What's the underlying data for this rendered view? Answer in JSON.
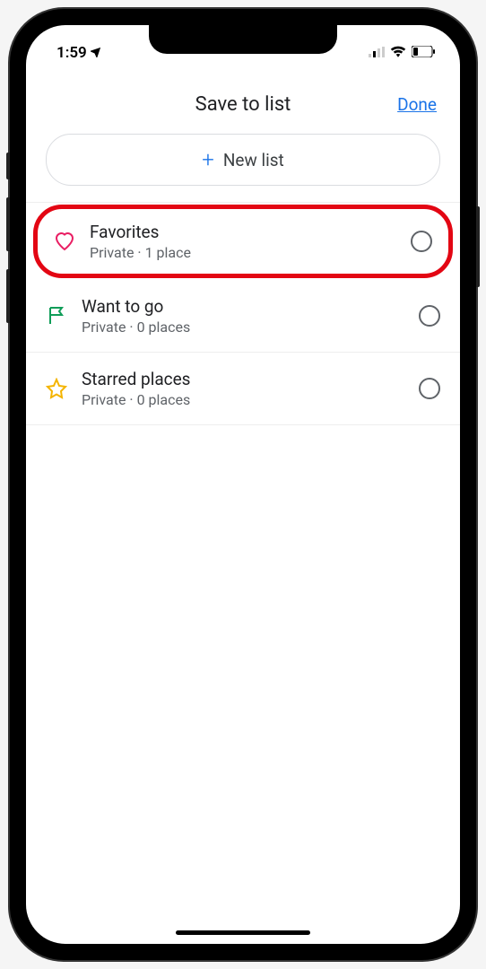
{
  "status_bar": {
    "time": "1:59"
  },
  "header": {
    "title": "Save to list",
    "done_label": "Done"
  },
  "new_list_button": {
    "label": "New list"
  },
  "lists": [
    {
      "title": "Favorites",
      "subtitle": "Private · 1 place",
      "icon": "heart",
      "icon_color": "#e91e63",
      "highlighted": true
    },
    {
      "title": "Want to go",
      "subtitle": "Private · 0 places",
      "icon": "flag",
      "icon_color": "#0f9d58",
      "highlighted": false
    },
    {
      "title": "Starred places",
      "subtitle": "Private · 0 places",
      "icon": "star",
      "icon_color": "#f4b400",
      "highlighted": false
    }
  ]
}
